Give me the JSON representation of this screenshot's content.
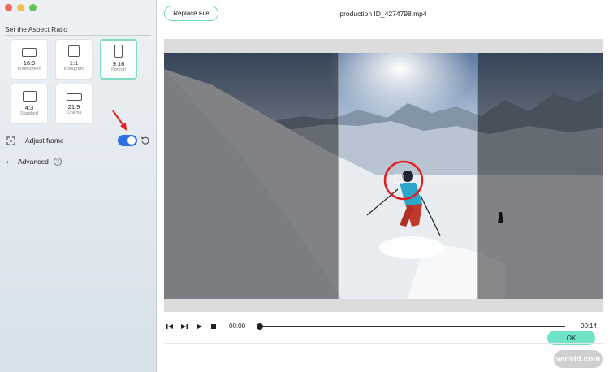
{
  "sidebar": {
    "section_title": "Set the Aspect Ratio",
    "ratios": [
      {
        "ratio": "16:9",
        "name": "Widescreen",
        "selected": false
      },
      {
        "ratio": "1:1",
        "name": "Instagram",
        "selected": false
      },
      {
        "ratio": "9:16",
        "name": "Portrait",
        "selected": true
      },
      {
        "ratio": "4:3",
        "name": "Standard",
        "selected": false
      },
      {
        "ratio": "21:9",
        "name": "Cinema",
        "selected": false
      }
    ],
    "adjust_frame_label": "Adjust frame",
    "adjust_frame_enabled": true,
    "advanced_label": "Advanced"
  },
  "header": {
    "replace_button": "Replace File",
    "file_name": "production ID_4274798.mp4"
  },
  "preview": {
    "ok_button": "OK"
  },
  "player": {
    "current_time": "00:00",
    "duration": "00:14"
  },
  "watermark": "wvtvid.com",
  "colors": {
    "accent": "#6fe3c5",
    "toggle": "#2f6fe6",
    "highlight_circle": "#e02020",
    "arrow": "#e02020"
  }
}
